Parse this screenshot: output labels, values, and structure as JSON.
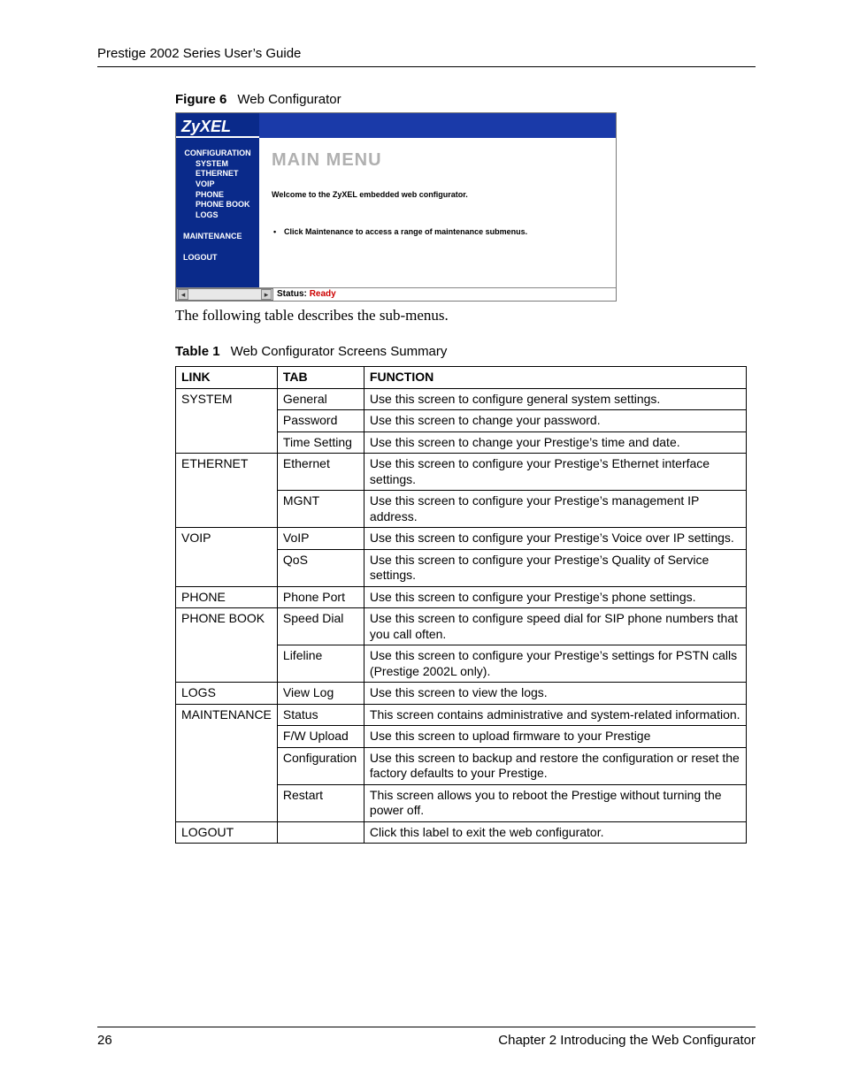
{
  "header": {
    "title": "Prestige 2002 Series User’s Guide"
  },
  "figure": {
    "label": "Figure 6",
    "title": "Web Configurator",
    "logo": "ZyXEL",
    "sidebar": {
      "group1_head": "CONFIGURATION",
      "subs": [
        "SYSTEM",
        "ETHERNET",
        "VOIP",
        "PHONE",
        "PHONE BOOK",
        "LOGS"
      ],
      "maintenance": "MAINTENANCE",
      "logout": "LOGOUT"
    },
    "main": {
      "heading": "MAIN MENU",
      "welcome": "Welcome to the ZyXEL embedded web configurator.",
      "bullet": "Click Maintenance to access a range of maintenance submenus."
    },
    "status": {
      "label": "Status:",
      "value": "Ready"
    }
  },
  "after_figure": "The following table describes the sub-menus.",
  "table": {
    "label": "Table 1",
    "title": "Web Configurator Screens Summary",
    "headers": [
      "LINK",
      "TAB",
      "FUNCTION"
    ],
    "rows": [
      {
        "link": "SYSTEM",
        "link_rows": 3,
        "tab": "General",
        "fn": "Use this screen to configure general system settings."
      },
      {
        "tab": "Password",
        "fn": "Use this screen to change your password."
      },
      {
        "tab": "Time Setting",
        "fn": "Use this screen to change your Prestige’s time and date."
      },
      {
        "link": "ETHERNET",
        "link_rows": 2,
        "tab": "Ethernet",
        "fn": "Use this screen to configure your Prestige’s Ethernet interface settings."
      },
      {
        "tab": "MGNT",
        "fn": "Use this screen to configure your Prestige’s management IP address."
      },
      {
        "link": "VOIP",
        "link_rows": 2,
        "tab": "VoIP",
        "fn": "Use this screen to configure your Prestige’s Voice over IP settings."
      },
      {
        "tab": "QoS",
        "fn": "Use this screen to configure your Prestige’s Quality of Service settings."
      },
      {
        "link": "PHONE",
        "link_rows": 1,
        "tab": "Phone Port",
        "fn": "Use this screen to configure your Prestige’s phone settings."
      },
      {
        "link": "PHONE BOOK",
        "link_rows": 2,
        "tab": "Speed Dial",
        "fn": "Use this screen to configure speed dial for SIP phone numbers that you call often."
      },
      {
        "tab": "Lifeline",
        "fn": "Use this screen to configure  your Prestige’s settings for PSTN calls (Prestige 2002L only)."
      },
      {
        "link": "LOGS",
        "link_rows": 1,
        "tab": "View Log",
        "fn": "Use this screen to view the logs."
      },
      {
        "link": "MAINTENANCE",
        "link_rows": 4,
        "tab": "Status",
        "fn": "This screen contains administrative and system-related information."
      },
      {
        "tab": "F/W Upload",
        "fn": "Use this screen to upload firmware to your Prestige"
      },
      {
        "tab": "Configuration",
        "fn": "Use this screen to backup and restore the configuration or reset the factory defaults to your Prestige."
      },
      {
        "tab": "Restart",
        "fn": "This screen allows you to reboot the Prestige without turning the power off."
      },
      {
        "link": "LOGOUT",
        "link_rows": 1,
        "tab": "",
        "fn": "Click this label to exit the web configurator."
      }
    ]
  },
  "footer": {
    "page": "26",
    "chapter": "Chapter 2 Introducing the Web Configurator"
  }
}
